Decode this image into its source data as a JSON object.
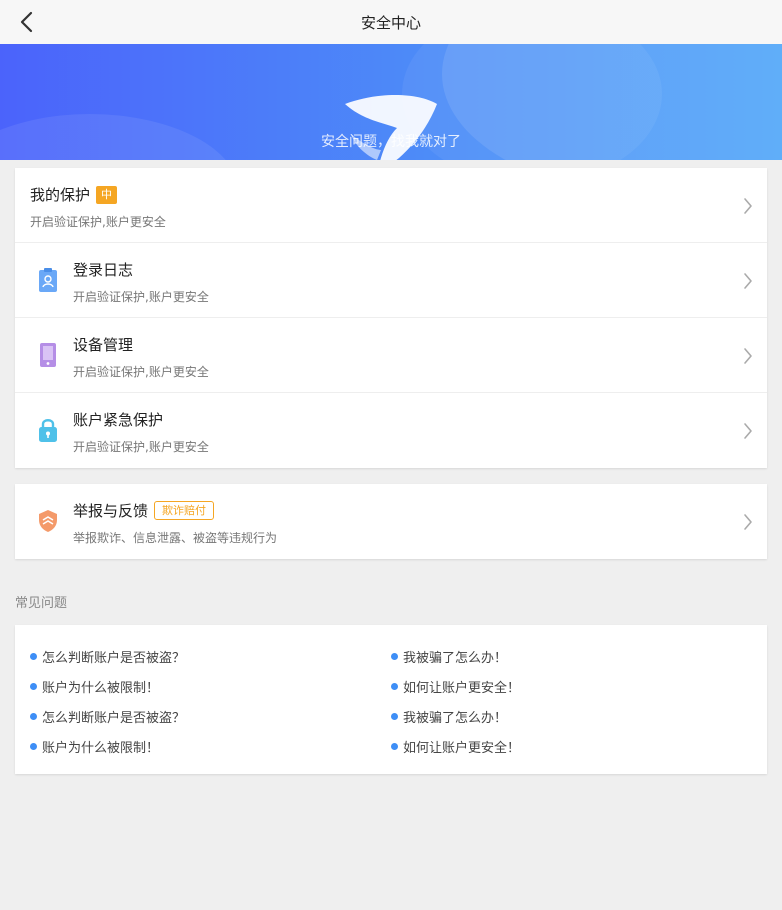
{
  "header": {
    "title": "安全中心"
  },
  "banner": {
    "slogan": "安全问题，找我就对了"
  },
  "protection": {
    "title": "我的保护",
    "level_badge": "中",
    "subtitle": "开启验证保护,账户更安全"
  },
  "menu": [
    {
      "title": "登录日志",
      "subtitle": "开启验证保护,账户更安全",
      "icon": "clipboard-user-icon",
      "color": "#6aa8f7"
    },
    {
      "title": "设备管理",
      "subtitle": "开启验证保护,账户更安全",
      "icon": "phone-icon",
      "color": "#b58ee6"
    },
    {
      "title": "账户紧急保护",
      "subtitle": "开启验证保护,账户更安全",
      "icon": "lock-icon",
      "color": "#4fc1e9"
    }
  ],
  "report": {
    "title": "举报与反馈",
    "badge": "欺诈赔付",
    "subtitle": "举报欺诈、信息泄露、被盗等违规行为",
    "icon": "report-shield-icon",
    "color": "#f49a6a"
  },
  "faq": {
    "title": "常见问题",
    "items": [
      "怎么判断账户是否被盗？",
      "我被骗了怎么办！",
      "账户为什么被限制！",
      "如何让账户更安全！",
      "怎么判断账户是否被盗？",
      "我被骗了怎么办！",
      "账户为什么被限制！",
      "如何让账户更安全！"
    ]
  },
  "colors": {
    "accent": "#3d8ef6",
    "badge": "#f5a623",
    "banner_start": "#4b63fb",
    "banner_end": "#4ea5f9"
  }
}
